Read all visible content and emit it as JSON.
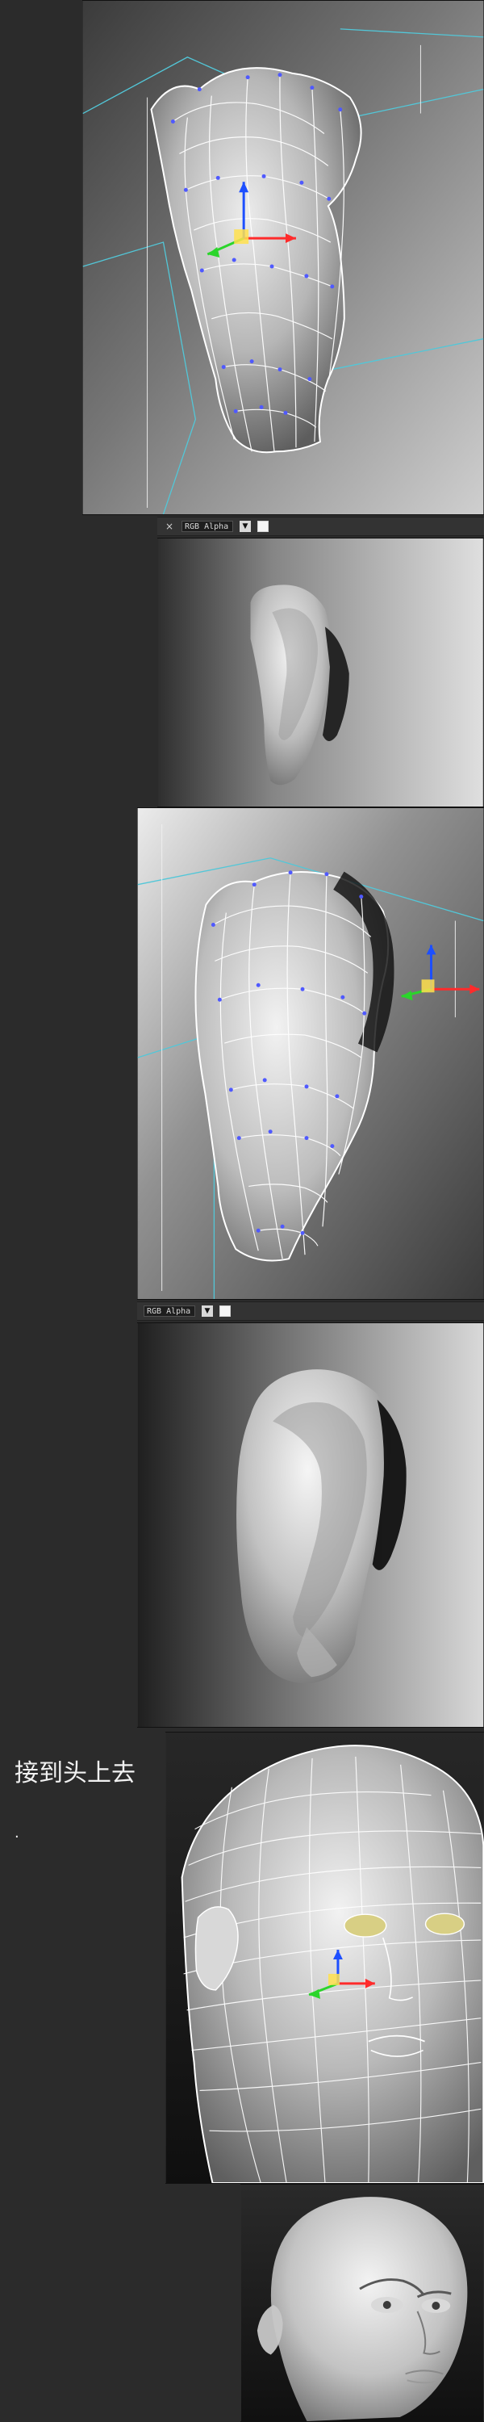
{
  "toolbar": {
    "render_channel": "RGB Alpha",
    "close_glyph": "×",
    "dropdown_glyph": "▼"
  },
  "caption": {
    "text": "接到头上去",
    "dot": "."
  },
  "colors": {
    "page_bg": "#2b2b2b",
    "toolbar_bg": "#333333",
    "cyan_wire": "#52c7d8",
    "mesh_line": "#ffffff",
    "vertex": "#4f59ff",
    "gizmo_x": "#ff2b2b",
    "gizmo_y": "#2bd52b",
    "gizmo_z": "#1d4fff",
    "gizmo_center": "#ffe04d"
  },
  "icons": {
    "close": "close-icon",
    "dropdown": "chevron-down-icon",
    "swatch": "white-swatch-icon"
  }
}
